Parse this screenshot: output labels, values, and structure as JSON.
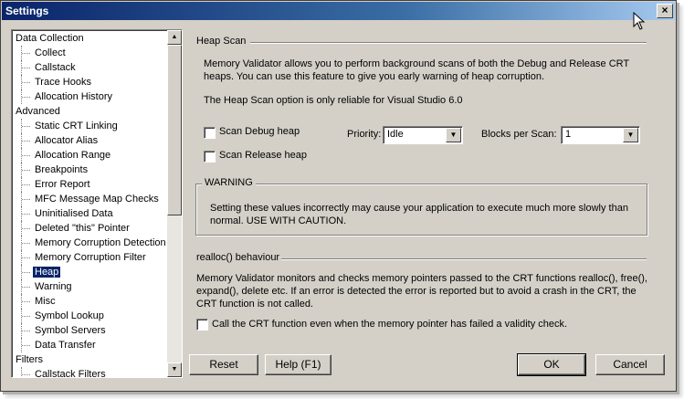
{
  "window": {
    "title": "Settings",
    "close_label": "×"
  },
  "tree": {
    "items": [
      {
        "label": "Data Collection",
        "type": "category"
      },
      {
        "label": "Collect",
        "type": "child"
      },
      {
        "label": "Callstack",
        "type": "child"
      },
      {
        "label": "Trace Hooks",
        "type": "child"
      },
      {
        "label": "Allocation History",
        "type": "child"
      },
      {
        "label": "Advanced",
        "type": "category"
      },
      {
        "label": "Static CRT Linking",
        "type": "child"
      },
      {
        "label": "Allocator Alias",
        "type": "child"
      },
      {
        "label": "Allocation Range",
        "type": "child"
      },
      {
        "label": "Breakpoints",
        "type": "child"
      },
      {
        "label": "Error Report",
        "type": "child"
      },
      {
        "label": "MFC Message Map Checks",
        "type": "child"
      },
      {
        "label": "Uninitialised Data",
        "type": "child"
      },
      {
        "label": "Deleted \"this\" Pointer",
        "type": "child"
      },
      {
        "label": "Memory Corruption Detection",
        "type": "child"
      },
      {
        "label": "Memory Corruption Filter",
        "type": "child"
      },
      {
        "label": "Heap",
        "type": "child",
        "selected": true
      },
      {
        "label": "Warning",
        "type": "child"
      },
      {
        "label": "Misc",
        "type": "child"
      },
      {
        "label": "Symbol Lookup",
        "type": "child"
      },
      {
        "label": "Symbol Servers",
        "type": "child"
      },
      {
        "label": "Data Transfer",
        "type": "child"
      },
      {
        "label": "Filters",
        "type": "category"
      },
      {
        "label": "Callstack Filters",
        "type": "child"
      }
    ],
    "scroll_up": "▲",
    "scroll_down": "▼"
  },
  "heap_scan": {
    "title": "Heap Scan",
    "description": "Memory Validator allows you to perform background scans of both the Debug and Release CRT heaps. You can use this feature to give you early warning of heap corruption.",
    "note": "The Heap Scan option is only reliable for Visual Studio 6.0",
    "scan_debug_label": "Scan Debug heap",
    "scan_release_label": "Scan Release heap",
    "priority_label": "Priority:",
    "priority_value": "Idle",
    "blocks_label": "Blocks per Scan:",
    "blocks_value": "1",
    "dropdown_arrow": "▼"
  },
  "warning": {
    "title": "WARNING",
    "text": "Setting these values incorrectly may cause your application to execute much more slowly than normal. USE WITH CAUTION."
  },
  "realloc": {
    "title": "realloc() behaviour",
    "text": "Memory Validator monitors and checks memory pointers passed to the CRT functions realloc(), free(), expand(), delete etc. If an error is detected the error is reported but to avoid a crash in the CRT, the CRT function is not called.",
    "checkbox_label": "Call the CRT function even when the memory pointer has failed a validity check."
  },
  "buttons": {
    "reset": "Reset",
    "help": "Help (F1)",
    "ok": "OK",
    "cancel": "Cancel"
  }
}
